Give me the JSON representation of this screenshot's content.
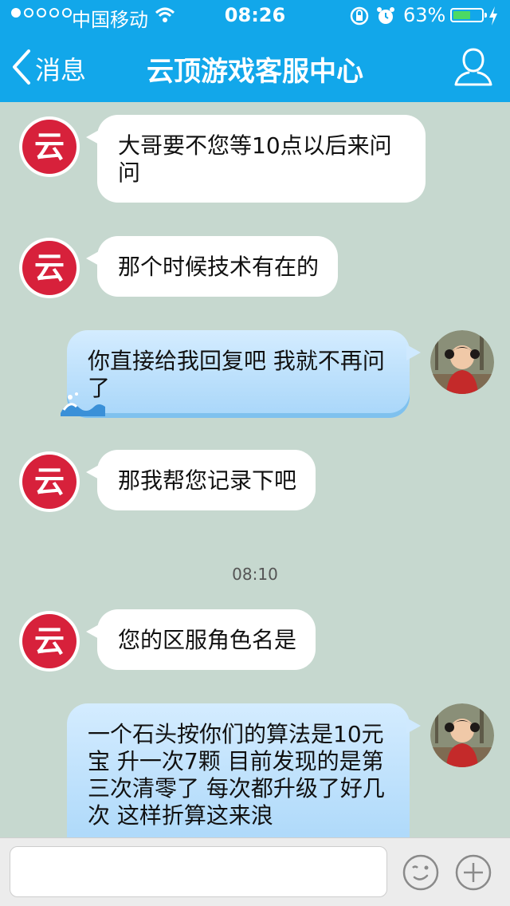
{
  "status_bar": {
    "carrier": "中国移动",
    "time": "08:26",
    "battery_percent": "63%",
    "battery_level": 0.63
  },
  "nav": {
    "back_label": "消息",
    "title": "云顶游戏客服中心",
    "icons": {
      "back": "chevron-left-icon",
      "profile": "person-icon"
    }
  },
  "colors": {
    "nav_bg": "#12a7ea",
    "chat_bg": "#c6d8cf",
    "bubble_incoming": "#ffffff",
    "bubble_outgoing": "#a8d6f9",
    "brand_logo": "#d7213b"
  },
  "messages": [
    {
      "side": "incoming",
      "text": "大哥要不您等10点以后来问问",
      "avatar": "yunding-logo-avatar"
    },
    {
      "side": "incoming",
      "text": "那个时候技术有在的",
      "avatar": "yunding-logo-avatar"
    },
    {
      "side": "outgoing",
      "text": "你直接给我回复吧   我就不再问了",
      "avatar": "user-photo-avatar"
    },
    {
      "side": "incoming",
      "text": "那我帮您记录下吧",
      "avatar": "yunding-logo-avatar"
    },
    {
      "side": "incoming",
      "text": "您的区服角色名是",
      "avatar": "yunding-logo-avatar"
    },
    {
      "side": "outgoing",
      "text": "一个石头按你们的算法是10元宝  升一次7颗   目前发现的是第三次清零了   每次都升级了好几次 这样折算这来浪",
      "avatar": "user-photo-avatar"
    }
  ],
  "timestamp": "08:10",
  "logo_text": "云",
  "input": {
    "value": "",
    "icons": {
      "emoji": "emoji-face-icon",
      "more": "plus-circle-icon"
    }
  }
}
